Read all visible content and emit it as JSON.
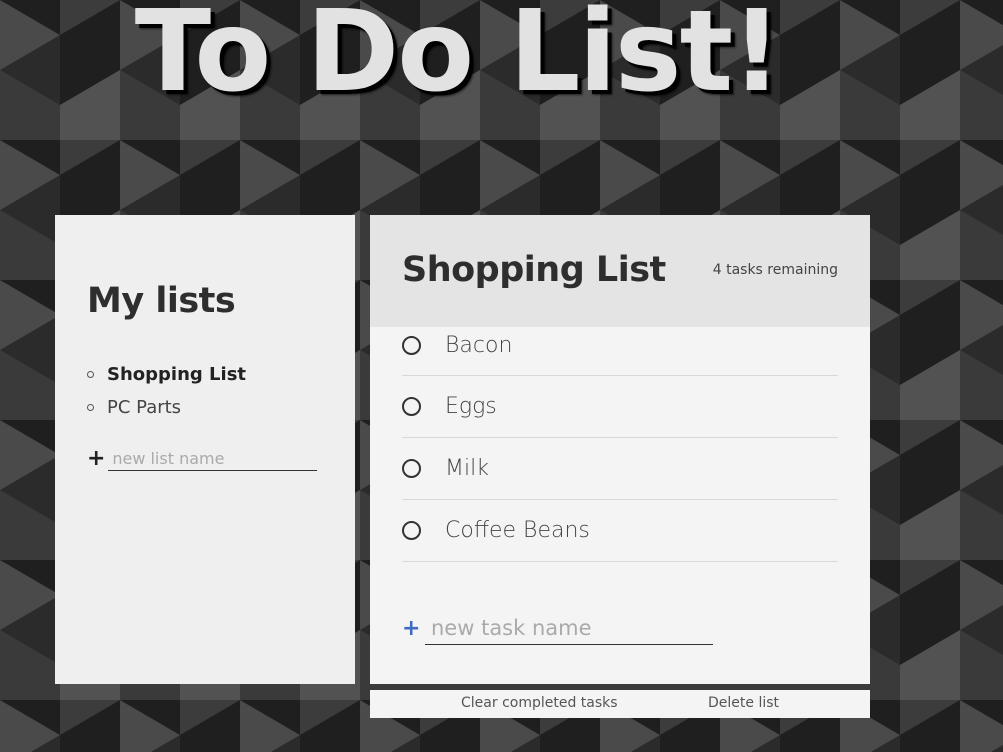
{
  "app": {
    "title": "To Do List!"
  },
  "colors": {
    "background": "#2c2c2c",
    "panel": "#efefef",
    "accent": "#3f6cc2"
  },
  "lists_panel": {
    "title": "My lists",
    "items": [
      {
        "label": "Shopping List",
        "active": true
      },
      {
        "label": "PC Parts",
        "active": false
      }
    ],
    "new_list": {
      "icon": "plus-icon",
      "placeholder": "new list name",
      "value": ""
    }
  },
  "todo_panel": {
    "title": "Shopping List",
    "count": "4 tasks remaining",
    "tasks": [
      {
        "label": "Bacon",
        "completed": false
      },
      {
        "label": "Eggs",
        "completed": false
      },
      {
        "label": "Milk",
        "completed": false
      },
      {
        "label": "Coffee Beans",
        "completed": false
      }
    ],
    "new_task": {
      "icon": "plus-icon",
      "placeholder": "new task name",
      "value": ""
    }
  },
  "footer": {
    "clear_completed": "Clear completed tasks",
    "delete_list": "Delete list"
  }
}
